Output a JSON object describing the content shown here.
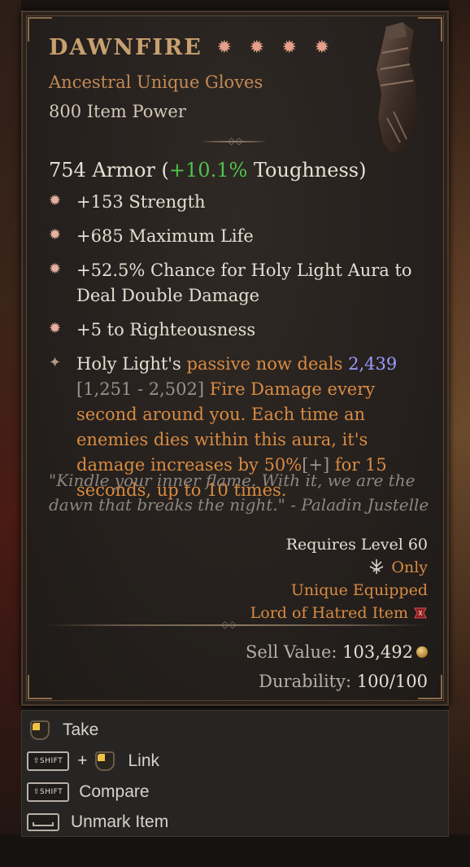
{
  "item": {
    "name": "DAWNFIRE",
    "type": "Ancestral Unique Gloves",
    "item_power": "800 Item Power",
    "armor_value": "754 Armor (",
    "toughness_pct": "+10.1%",
    "toughness_label": " Toughness)",
    "affixes": [
      {
        "text": "+153 Strength"
      },
      {
        "text": "+685 Maximum Life"
      },
      {
        "text": "+52.5% Chance for Holy Light Aura to Deal Double Damage"
      },
      {
        "text": "+5 to Righteousness"
      }
    ],
    "unique_power": {
      "p1": "Holy Light's ",
      "p2": "passive now deals ",
      "p3": "2,439",
      "p4": "[1,251 - 2,502]",
      "p5": " Fire Damage every second around you. Each time an enemies dies within this aura, it's damage increases by 50%",
      "p6": "[+]",
      "p7": " for 15 seconds, up to 10 times."
    },
    "flavor": "\"Kindle your inner flame. With it, we are the dawn that breaks the night.\" - Paladin Justelle",
    "requires_level": "Requires Level 60",
    "class_only": "Only",
    "unique_equipped": "Unique Equipped",
    "expansion_item": "Lord of Hatred Item",
    "sell_label": "Sell Value: ",
    "sell_value": "103,492",
    "durability_label": "Durability: ",
    "durability_value": "100/100"
  },
  "actions": {
    "take": "Take",
    "shift_key": "SHIFT",
    "plus": "+",
    "link": "Link",
    "compare": "Compare",
    "unmark": "Unmark Item"
  },
  "colors": {
    "title": "#c8a070",
    "unique_orange": "#d98b42",
    "toughness_green": "#4ec24e",
    "value_blue": "#9a9cff"
  },
  "icons": {
    "rank_star": "eight-point-star-icon",
    "affix_bullet": "affix-bullet-icon",
    "unique_bullet": "unique-power-bullet-icon",
    "class": "paladin-class-icon",
    "expansion": "lord-of-hatred-icon",
    "gold": "gold-coin-icon"
  }
}
